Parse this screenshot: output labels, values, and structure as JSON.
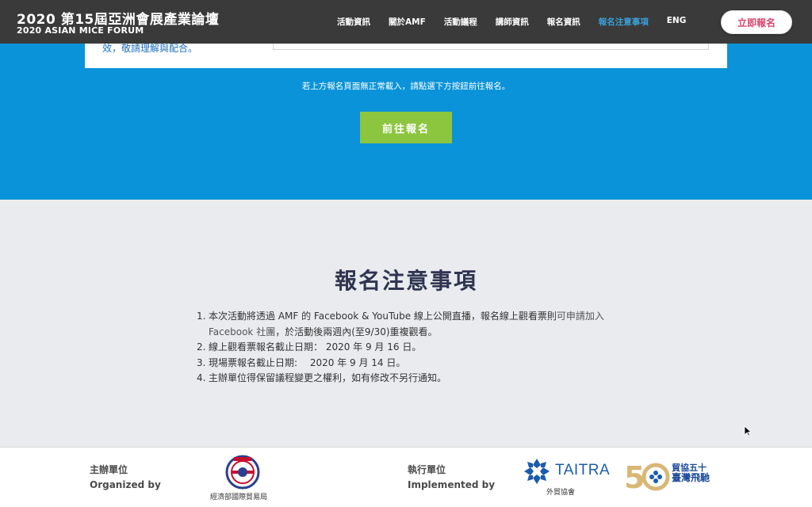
{
  "header": {
    "brand_zh": "2020 第15屆亞洲會展產業論壇",
    "brand_en": "2020 ASIAN MICE FORUM",
    "nav": [
      {
        "label": "活動資訊",
        "active": false
      },
      {
        "label": "關於AMF",
        "active": false
      },
      {
        "label": "活動議程",
        "active": false
      },
      {
        "label": "講師資訊",
        "active": false
      },
      {
        "label": "報名資訊",
        "active": false
      },
      {
        "label": "報名注意事項",
        "active": true
      },
      {
        "label": "ENG",
        "active": false
      }
    ],
    "cta_label": "立即報名"
  },
  "registration": {
    "card_text": "效，敬請理解與配合。",
    "note": "若上方報名頁面無正常載入，請點選下方按鈕前往報名。",
    "button_label": "前往報名"
  },
  "notes": {
    "title": "報名注意事項",
    "items": [
      {
        "num": "1.",
        "text_a": "本次活動將透過 AMF 的 Facebook & YouTube 線上公開直播，報名線上觀看票則",
        "link": "可申請加入 Facebook 社團",
        "text_b": "，於活動後兩週內(至9/30)重複觀看。"
      },
      {
        "num": "2.",
        "text": "線上觀看票報名截止日期： 2020 年 9 月 16 日。"
      },
      {
        "num": "3.",
        "text": "現場票報名截止日期:　 2020 年 9 月 14 日。"
      },
      {
        "num": "4.",
        "text": "主辦單位得保留議程變更之權利，如有修改不另行通知。"
      }
    ]
  },
  "footer": {
    "organizer_zh": "主辦單位",
    "organizer_en": "Organized by",
    "organizer_logo_caption": "經濟部國際貿易局",
    "implementer_zh": "執行單位",
    "implementer_en": "Implemented by",
    "taitra_name": "TAITRA",
    "taitra_caption": "外貿協會",
    "fifty_line1": "貿協五十",
    "fifty_line2": "臺灣飛馳",
    "colors": {
      "brand_blue": "#1c5cab",
      "section_blue": "#0a93d8",
      "button_green": "#8cc63f",
      "cta_pink": "#d8446a"
    }
  }
}
